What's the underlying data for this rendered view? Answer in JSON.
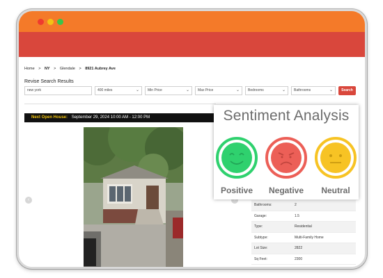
{
  "window": {
    "controls": [
      "close",
      "minimize",
      "maximize"
    ],
    "colors": {
      "titlebar": "#f47a29",
      "nav": "#d9473c"
    }
  },
  "breadcrumb": {
    "items": [
      "Home",
      ">",
      "NY",
      ">",
      "Glendale",
      ">",
      "8921 Aubrey Ave"
    ]
  },
  "search": {
    "heading": "Revise Search Results",
    "location_value": "new york",
    "radius_value": "400 miles",
    "min_price": "Min Price",
    "max_price": "Max Price",
    "bedrooms": "Bedrooms",
    "bathrooms": "Bathrooms",
    "button_label": "Search"
  },
  "open_house": {
    "label": "Next Open House:",
    "date": "September 29, 2024 10:00 AM - 12:00 PM"
  },
  "gallery": {
    "prev_icon": "chevron-left-icon",
    "next_icon": "chevron-right-icon"
  },
  "details": [
    {
      "key": "Bathrooms:",
      "value": "2"
    },
    {
      "key": "Garage:",
      "value": "1.5"
    },
    {
      "key": "Type:",
      "value": "Residential"
    },
    {
      "key": "Subtype:",
      "value": "Multi-Family Home"
    },
    {
      "key": "Lot Size:",
      "value": "2822"
    },
    {
      "key": "Sq Feet:",
      "value": "2300"
    }
  ],
  "sentiment": {
    "title": "Sentiment Analysis",
    "positive": {
      "label": "Positive",
      "color": "#2fd16e"
    },
    "negative": {
      "label": "Negative",
      "color": "#ec5f57"
    },
    "neutral": {
      "label": "Neutral",
      "color": "#f7c324"
    }
  }
}
